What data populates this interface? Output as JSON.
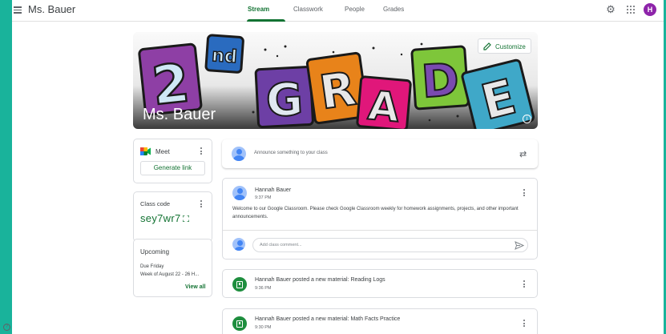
{
  "header": {
    "class_name": "Ms. Bauer",
    "tabs": [
      {
        "label": "Stream",
        "active": true
      },
      {
        "label": "Classwork",
        "active": false
      },
      {
        "label": "People",
        "active": false
      },
      {
        "label": "Grades",
        "active": false
      }
    ],
    "avatar_letter": "H",
    "icons": [
      "menu-icon",
      "gear-icon",
      "apps-grid-icon"
    ]
  },
  "banner": {
    "title": "Ms. Bauer",
    "customize_label": "Customize",
    "artwork_text": "2nd GRADE"
  },
  "meet": {
    "label": "Meet",
    "generate_label": "Generate link"
  },
  "class_code": {
    "label": "Class code",
    "value": "sey7wr7"
  },
  "upcoming": {
    "title": "Upcoming",
    "due": "Due Friday",
    "item": "Week of August 22 - 26 H...",
    "view_all": "View all"
  },
  "stream": {
    "announce_placeholder": "Announce something to your class",
    "post": {
      "author": "Hannah Bauer",
      "time": "9:37 PM",
      "body": "Welcome to our Google Classroom. Please check Google Classroom weekly for homework assignments, projects, and other important announcements.",
      "comment_placeholder": "Add class comment..."
    },
    "materials": [
      {
        "title": "Hannah Bauer posted a new material: Reading Logs",
        "time": "9:36 PM"
      },
      {
        "title": "Hannah Bauer posted a new material: Math Facts Practice",
        "time": "9:30 PM"
      }
    ]
  },
  "colors": {
    "accent_green": "#137333",
    "frame_teal": "#19b39b",
    "avatar_purple": "#8e24aa"
  }
}
